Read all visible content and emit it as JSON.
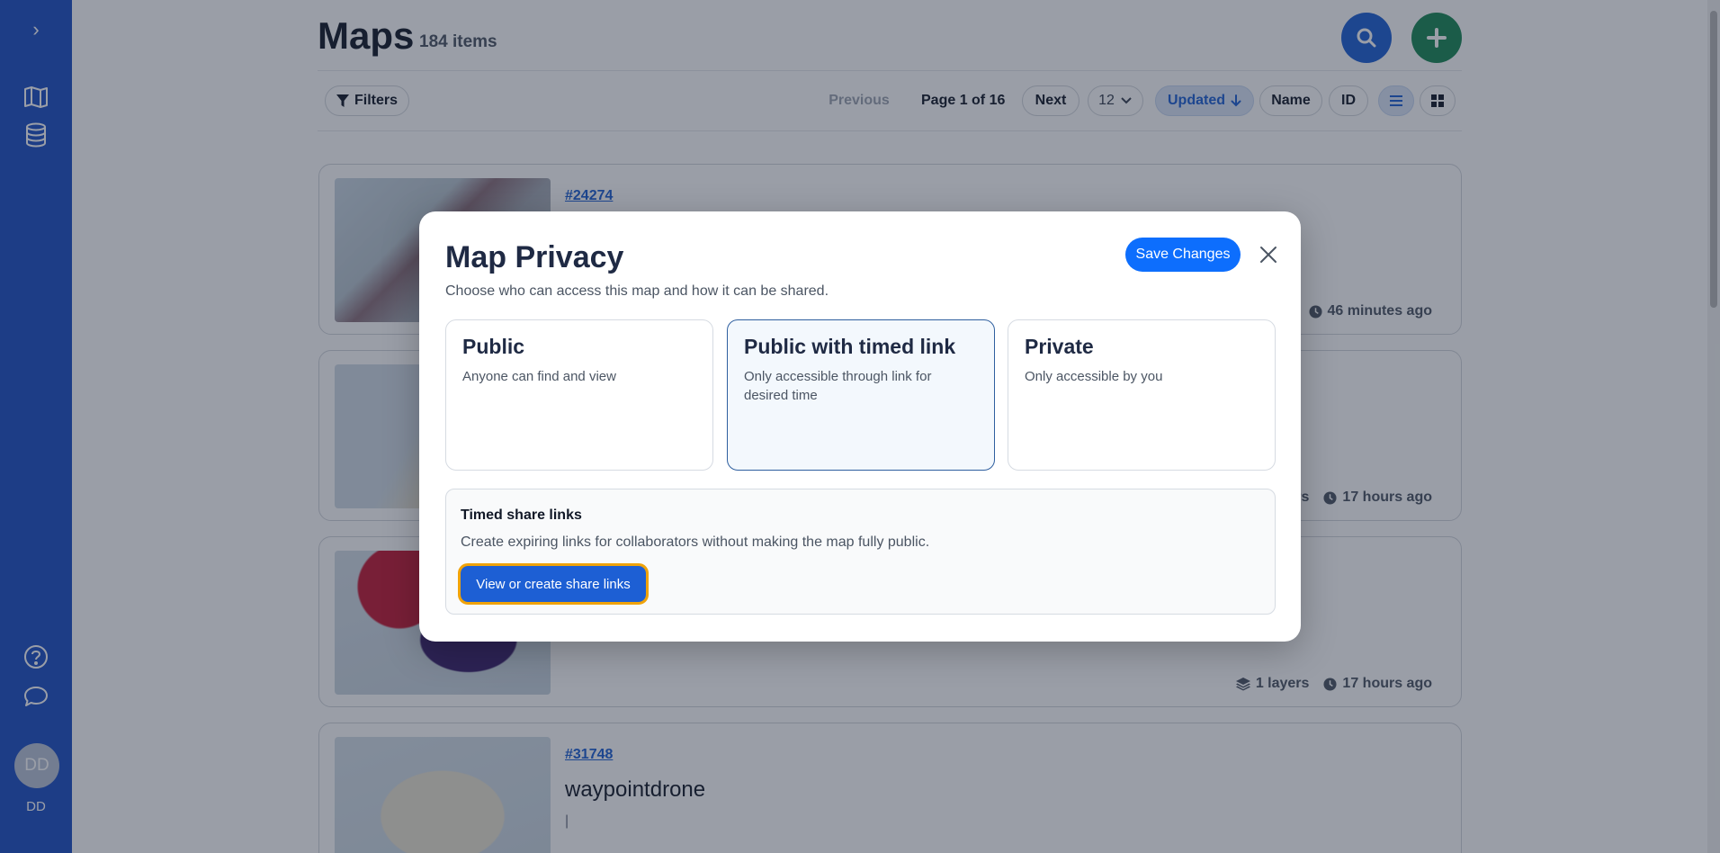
{
  "sidebar": {
    "expand_glyph": "›",
    "icons": [
      "chevron-right-icon",
      "map-icon",
      "database-icon",
      "help-icon",
      "chat-icon"
    ],
    "avatar_initials": "DD",
    "user_label": "DD"
  },
  "header": {
    "title": "Maps",
    "count": "184 items"
  },
  "toolbar": {
    "filters_label": "Filters",
    "previous_label": "Previous",
    "page_info": "Page 1 of 16",
    "next_label": "Next",
    "per_page": "12",
    "sort_updated": "Updated",
    "sort_name": "Name",
    "sort_id": "ID"
  },
  "cards": [
    {
      "id": "#24274",
      "name": "",
      "desc": "",
      "layers": "",
      "updated": "46 minutes ago"
    },
    {
      "id": "",
      "name": "",
      "desc": "",
      "layers": "rs",
      "updated": "17 hours ago"
    },
    {
      "id": "",
      "name": "",
      "desc": "",
      "layers": "1 layers",
      "updated": "17 hours ago"
    },
    {
      "id": "#31748",
      "name": "waypointdrone",
      "desc": "|",
      "layers": "",
      "updated": ""
    }
  ],
  "modal": {
    "title": "Map Privacy",
    "subtitle": "Choose who can access this map and how it can be shared.",
    "save_label": "Save Changes",
    "options": [
      {
        "title": "Public",
        "desc": "Anyone can find and view"
      },
      {
        "title": "Public with timed link",
        "desc": "Only accessible through link for desired time"
      },
      {
        "title": "Private",
        "desc": "Only accessible by you"
      }
    ],
    "selected_option": "Public with timed link",
    "share": {
      "title": "Timed share links",
      "desc": "Create expiring links for collaborators without making the map fully public.",
      "button_label": "View or create share links"
    }
  },
  "colors": {
    "sidebar": "#1d4fc4",
    "primary": "#0d6efd",
    "add": "#198754",
    "focus_ring": "#f0a30a"
  }
}
